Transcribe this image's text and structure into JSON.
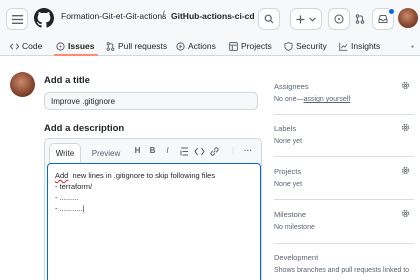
{
  "header": {
    "owner": "Formation-Git-et-Git-actions",
    "separator": "/",
    "repo": "GitHub-actions-ci-cd"
  },
  "nav": {
    "code": "Code",
    "issues": "Issues",
    "pull_requests": "Pull requests",
    "actions": "Actions",
    "projects": "Projects",
    "security": "Security",
    "insights": "Insights"
  },
  "form": {
    "title_label": "Add a title",
    "title_value": "Improve .gitignore",
    "description_label": "Add a description",
    "tab_write": "Write",
    "tab_preview": "Preview",
    "toolbar": {
      "heading": "H",
      "bold": "B",
      "italic": "I",
      "more": "···"
    },
    "description_lines": [
      "new lines in .gitignore to skip following files",
      "- terraform/",
      "- .........",
      "- ...........|"
    ],
    "first_word": "Add"
  },
  "sidebar": {
    "assignees": {
      "title": "Assignees",
      "value": "No one—",
      "link": "assign yourself"
    },
    "labels": {
      "title": "Labels",
      "value": "None yet"
    },
    "projects": {
      "title": "Projects",
      "value": "None yet"
    },
    "milestone": {
      "title": "Milestone",
      "value": "No milestone"
    },
    "development": {
      "title": "Development",
      "value": "Shows branches and pull requests linked to"
    }
  },
  "colors": {
    "accent": "#0969da",
    "nav_underline": "#fd8c73",
    "squiggle": "#cf222e"
  }
}
